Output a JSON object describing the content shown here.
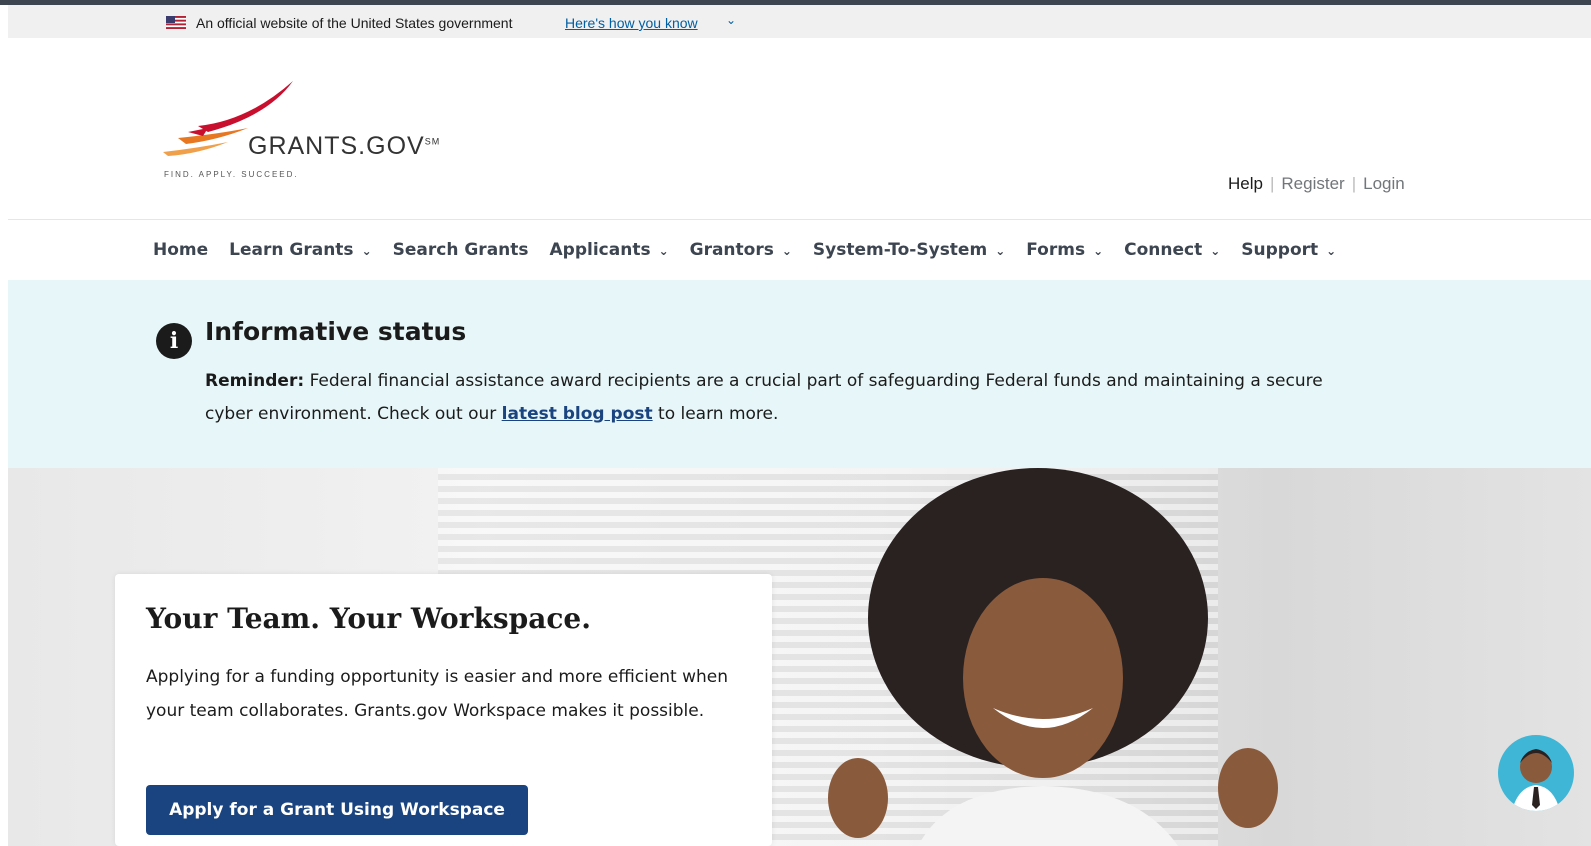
{
  "gov_banner": {
    "official_text": "An official website of the United States government",
    "how_you_know": "Here's how you know",
    "flag_icon": "us-flag-icon"
  },
  "logo": {
    "wordmark": "GRANTS.GOV",
    "trademark": "SM",
    "tagline": "FIND. APPLY. SUCCEED."
  },
  "utility": {
    "help": "Help",
    "register": "Register",
    "login": "Login"
  },
  "nav": {
    "items": [
      {
        "label": "Home",
        "dropdown": false
      },
      {
        "label": "Learn Grants",
        "dropdown": true
      },
      {
        "label": "Search Grants",
        "dropdown": false
      },
      {
        "label": "Applicants",
        "dropdown": true
      },
      {
        "label": "Grantors",
        "dropdown": true
      },
      {
        "label": "System-To-System",
        "dropdown": true
      },
      {
        "label": "Forms",
        "dropdown": true
      },
      {
        "label": "Connect",
        "dropdown": true
      },
      {
        "label": "Support",
        "dropdown": true
      }
    ]
  },
  "alert": {
    "title": "Informative status",
    "reminder_label": "Reminder:",
    "message_before": "Federal financial assistance award recipients are a crucial part of safeguarding Federal funds and maintaining a secure cyber environment. Check out our",
    "link_text": "latest blog post",
    "message_after": "to learn more."
  },
  "hero": {
    "title": "Your Team. Your Workspace.",
    "body": "Applying for a funding opportunity is easier and more efficient when your team collaborates. Grants.gov Workspace makes it possible.",
    "cta": "Apply for a Grant Using Workspace"
  },
  "colors": {
    "primary": "#1a4480",
    "alert_bg": "#e7f6f8",
    "logo_red": "#c8102e",
    "logo_orange": "#e87722"
  }
}
